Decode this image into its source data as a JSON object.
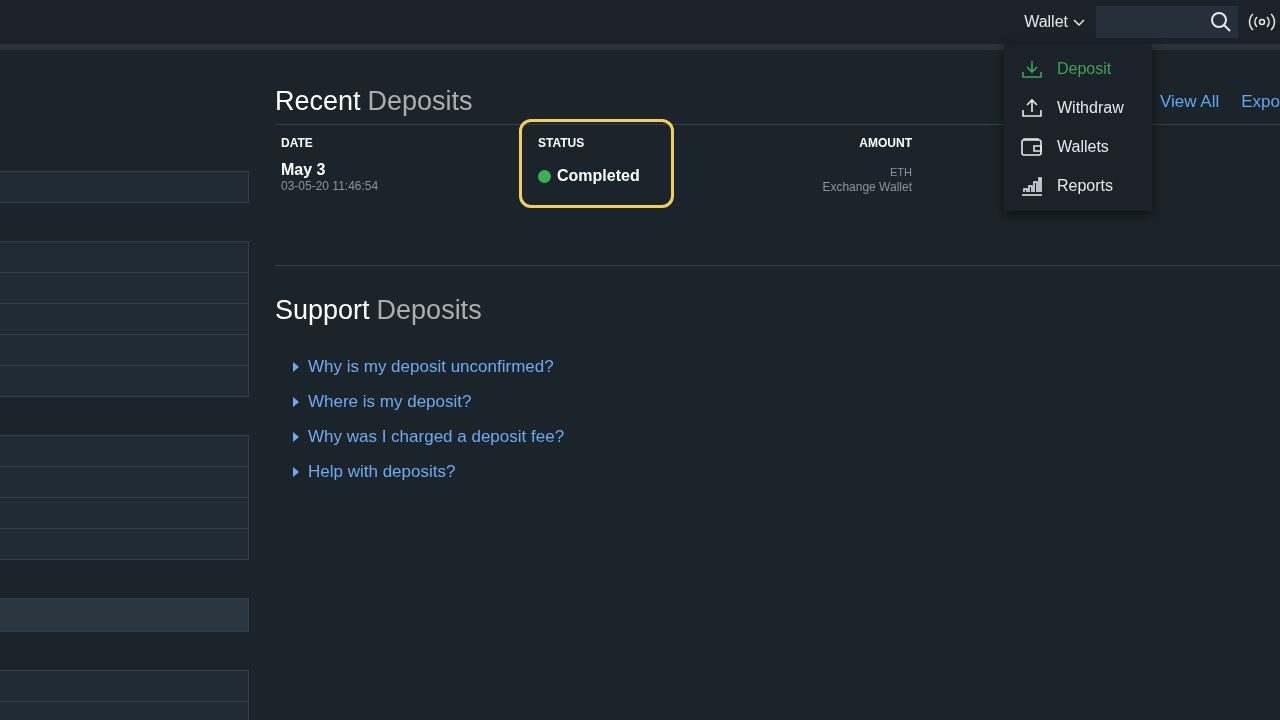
{
  "topbar": {
    "menu_label": "Wallet"
  },
  "sidebar": {
    "groups": [
      {
        "rows": [
          {
            "selected": false
          }
        ]
      },
      {
        "rows": [
          {
            "selected": false
          },
          {
            "selected": false
          },
          {
            "selected": false
          },
          {
            "selected": false
          },
          {
            "selected": false
          }
        ]
      },
      {
        "rows": [
          {
            "selected": false
          },
          {
            "selected": false
          },
          {
            "selected": false
          },
          {
            "selected": false
          }
        ]
      },
      {
        "rows": [
          {
            "selected": true
          }
        ]
      },
      {
        "rows": [
          {
            "selected": false
          },
          {
            "selected": false
          }
        ]
      }
    ]
  },
  "recent": {
    "title": "Recent",
    "title_accent": "Deposits",
    "links": [
      "View All",
      "Expo"
    ],
    "columns": [
      {
        "label": "DATE",
        "highlighted": false
      },
      {
        "label": "STATUS",
        "highlighted": true
      },
      {
        "label": "AMOUNT",
        "highlighted": false
      }
    ],
    "rows": [
      {
        "date": "May 3",
        "timestamp": "03-05-20 11:46:54",
        "status": "Completed",
        "color": "#3cb054",
        "currency": "ETH",
        "wallet": "Exchange Wallet"
      }
    ]
  },
  "support": {
    "title": "Support",
    "title_accent": "Deposits",
    "links": [
      "Why is my deposit unconfirmed?",
      "Where is my deposit?",
      "Why was I charged a deposit fee?",
      "Help with deposits?"
    ]
  },
  "wallet_menu": {
    "items": [
      {
        "label": "Deposit",
        "selected": true
      },
      {
        "label": "Withdraw",
        "selected": false
      },
      {
        "label": "Wallets",
        "selected": false
      },
      {
        "label": "Reports",
        "selected": false
      }
    ]
  }
}
